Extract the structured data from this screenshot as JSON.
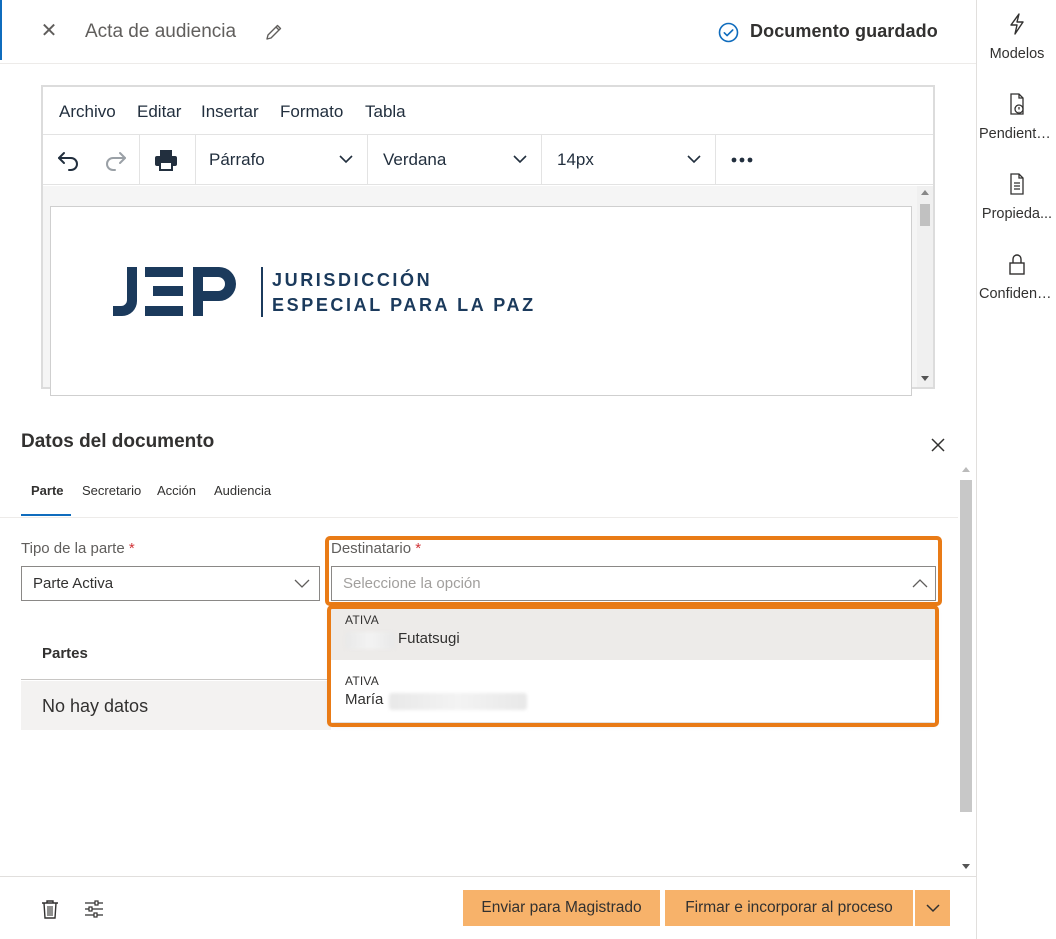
{
  "header": {
    "title": "Acta de audiencia",
    "status": "Documento guardado"
  },
  "rail": [
    {
      "label": "Modelos",
      "icon": "bolt-icon"
    },
    {
      "label": "Pendiente...",
      "icon": "document-info-icon"
    },
    {
      "label": "Propieda...",
      "icon": "document-list-icon"
    },
    {
      "label": "Confidenc...",
      "icon": "lock-icon"
    }
  ],
  "editor": {
    "menu": [
      "Archivo",
      "Editar",
      "Insertar",
      "Formato",
      "Tabla"
    ],
    "block_format": "Párrafo",
    "font_family": "Verdana",
    "font_size": "14px",
    "logo": {
      "mark": "JEP",
      "line1": "JURISDICCIÓN",
      "line2": "ESPECIAL PARA LA PAZ",
      "color": "#1b3a5c"
    }
  },
  "panel": {
    "title": "Datos del documento",
    "tabs": [
      "Parte",
      "Secretario",
      "Acción",
      "Audiencia"
    ],
    "active_tab": "Parte",
    "tipo_label": "Tipo de la parte",
    "tipo_value": "Parte Activa",
    "destinatario_label": "Destinatario",
    "destinatario_placeholder": "Seleccione la opción",
    "required_mark": "*",
    "table_header": "Partes",
    "empty_text": "No hay datos",
    "options": [
      {
        "tag": "ATIVA",
        "name": "Futatsugi",
        "selected": true
      },
      {
        "tag": "ATIVA",
        "name": "María",
        "selected": false
      }
    ]
  },
  "footer": {
    "send_label": "Enviar para Magistrado",
    "sign_label": "Firmar e incorporar al proceso"
  },
  "colors": {
    "accent": "#0f6cbd",
    "highlight": "#e97b16",
    "button": "#f7b26a"
  }
}
